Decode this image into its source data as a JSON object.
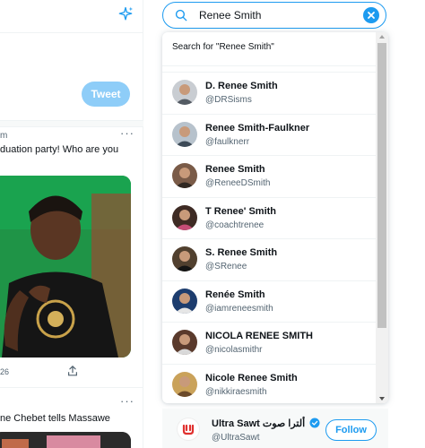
{
  "timeline": {
    "tweet_button": "Tweet",
    "tweet1": {
      "handle_fragment": "m",
      "more": "···",
      "text_fragment": "duation party! Who are you",
      "reply_count_fragment": "26"
    },
    "tweet2": {
      "more": "···",
      "text_fragment": "ne Chebet tells Massawe"
    }
  },
  "search": {
    "value": "Renee Smith",
    "search_for_label": "Search for \"Renee Smith\""
  },
  "results": [
    {
      "name": "D. Renee Smith",
      "handle": "@DRSisms",
      "avatar_colors": [
        "#c9cdd2",
        "#545b63"
      ]
    },
    {
      "name": "Renee Smith-Faulkner",
      "handle": "@faulknerr",
      "avatar_colors": [
        "#b7c2cc",
        "#3d4a57"
      ]
    },
    {
      "name": "Renee Smith",
      "handle": "@ReneeDSmith",
      "avatar_colors": [
        "#7a5b48",
        "#2f2721"
      ]
    },
    {
      "name": "T Renee' Smith",
      "handle": "@coachtrenee",
      "avatar_colors": [
        "#3e2b24",
        "#c44d76"
      ]
    },
    {
      "name": "S. Renee Smith",
      "handle": "@SRenee",
      "avatar_colors": [
        "#51402f",
        "#141414"
      ]
    },
    {
      "name": "Renée Smith",
      "handle": "@iamreneesmith",
      "avatar_colors": [
        "#1d3d6e",
        "#e6e6e6"
      ]
    },
    {
      "name": "NICOLA RENEE SMITH",
      "handle": "@nicolasmithr",
      "avatar_colors": [
        "#5a3a2c",
        "#d9d9d9"
      ]
    },
    {
      "name": "Nicole Renee Smith",
      "handle": "@nikkiraesmith",
      "avatar_colors": [
        "#caa25a",
        "#6b4a2a"
      ]
    }
  ],
  "who_to_follow": {
    "name": "Ultra Sawt ألترا صوت",
    "handle": "@UltraSawt",
    "follow_label": "Follow",
    "brand_color": "#e0312f"
  },
  "colors": {
    "accent": "#1d9bf0",
    "tweet_button_disabled": "#8ecdf8",
    "secondary_text": "#536471"
  }
}
